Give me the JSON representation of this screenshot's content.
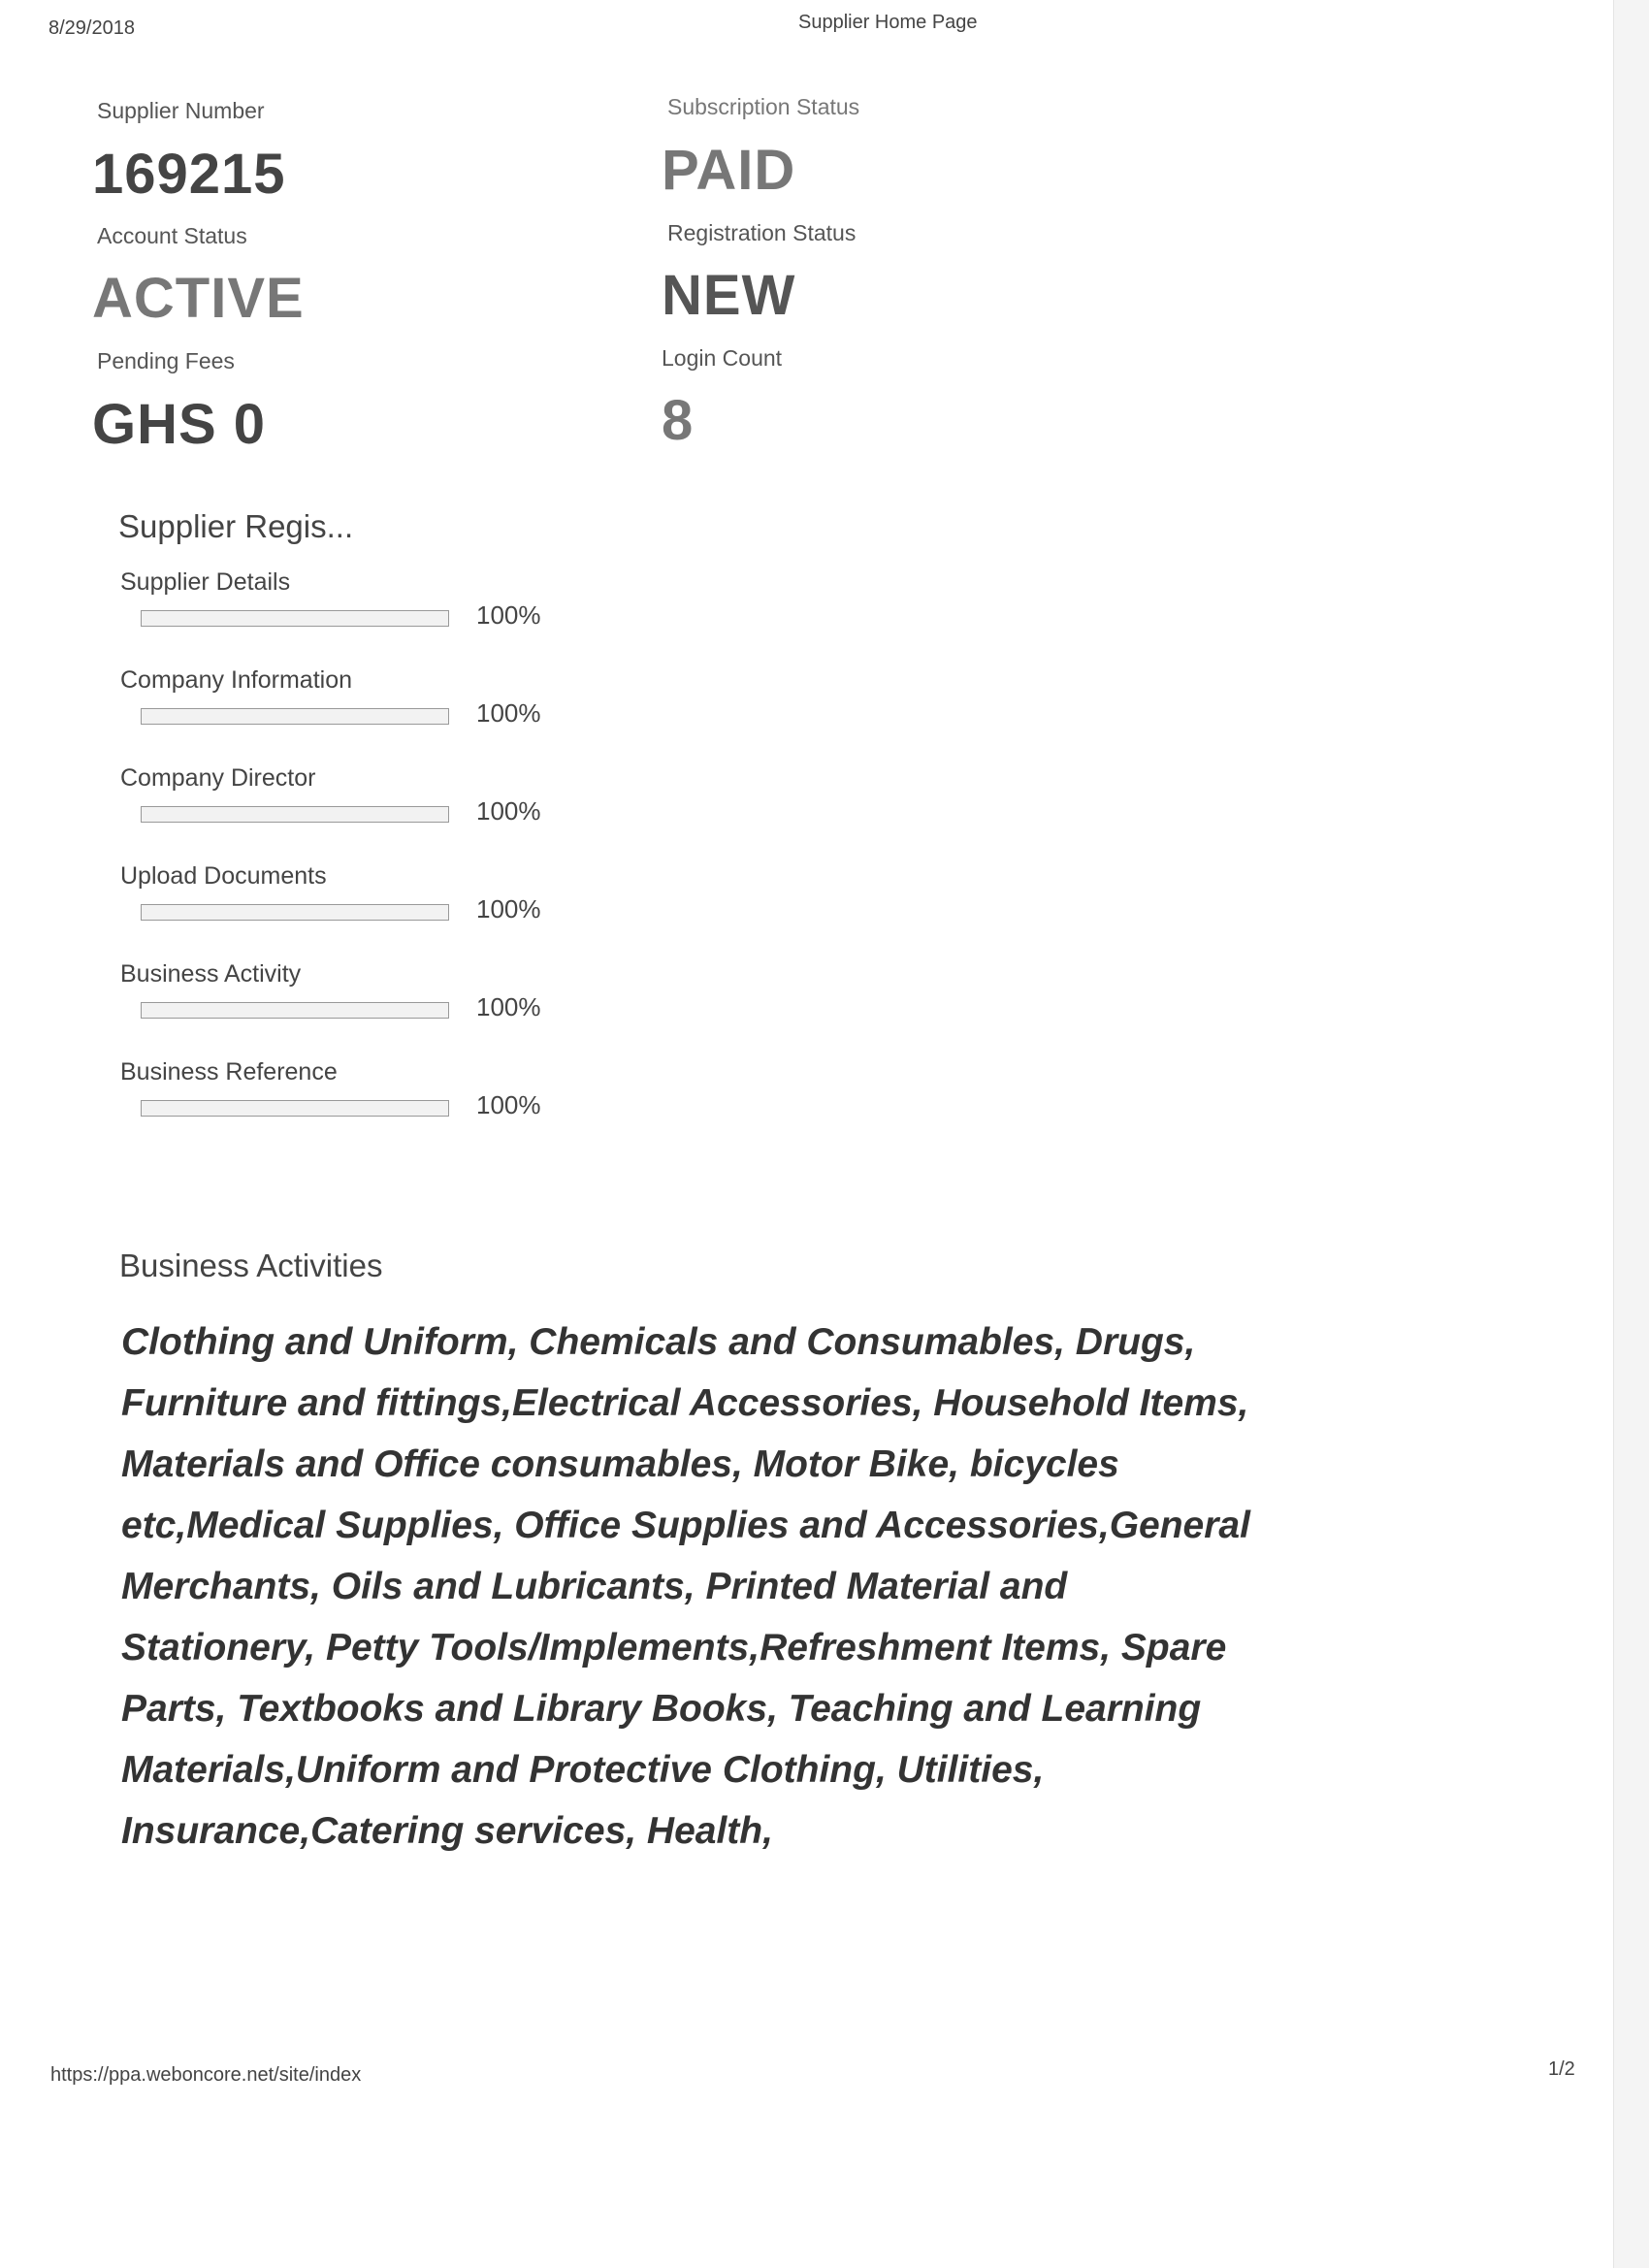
{
  "header": {
    "date": "8/29/2018",
    "title": "Supplier Home Page"
  },
  "summary": {
    "supplier_number_label": "Supplier Number",
    "supplier_number": "169215",
    "subscription_status_label": "Subscription Status",
    "subscription_status": "PAID",
    "account_status_label": "Account Status",
    "account_status": "ACTIVE",
    "registration_status_label": "Registration Status",
    "registration_status": "NEW",
    "pending_fees_label": "Pending Fees",
    "pending_fees": "GHS 0",
    "login_count_label": "Login Count",
    "login_count": "8"
  },
  "registration": {
    "title": "Supplier Regis...",
    "items": [
      {
        "label": "Supplier Details",
        "percent_text": "100%",
        "progress": 100
      },
      {
        "label": "Company Information",
        "percent_text": "100%",
        "progress": 100
      },
      {
        "label": "Company Director",
        "percent_text": "100%",
        "progress": 100
      },
      {
        "label": "Upload Documents",
        "percent_text": "100%",
        "progress": 100
      },
      {
        "label": "Business Activity",
        "percent_text": "100%",
        "progress": 100
      },
      {
        "label": "Business Reference",
        "percent_text": "100%",
        "progress": 100
      }
    ]
  },
  "business_activities": {
    "title": "Business Activities",
    "text": "Clothing and Uniform, Chemicals and Consumables, Drugs, Furniture and fittings,Electrical Accessories, Household Items, Materials and Office consumables, Motor Bike, bicycles etc,Medical Supplies, Office Supplies and Accessories,General Merchants, Oils and Lubricants, Printed Material and Stationery, Petty Tools/Implements,Refreshment Items, Spare Parts, Textbooks and Library Books, Teaching and Learning Materials,Uniform and Protective Clothing, Utilities, Insurance,Catering services, Health,"
  },
  "footer": {
    "url": "https://ppa.weboncore.net/site/index",
    "page": "1/2"
  }
}
